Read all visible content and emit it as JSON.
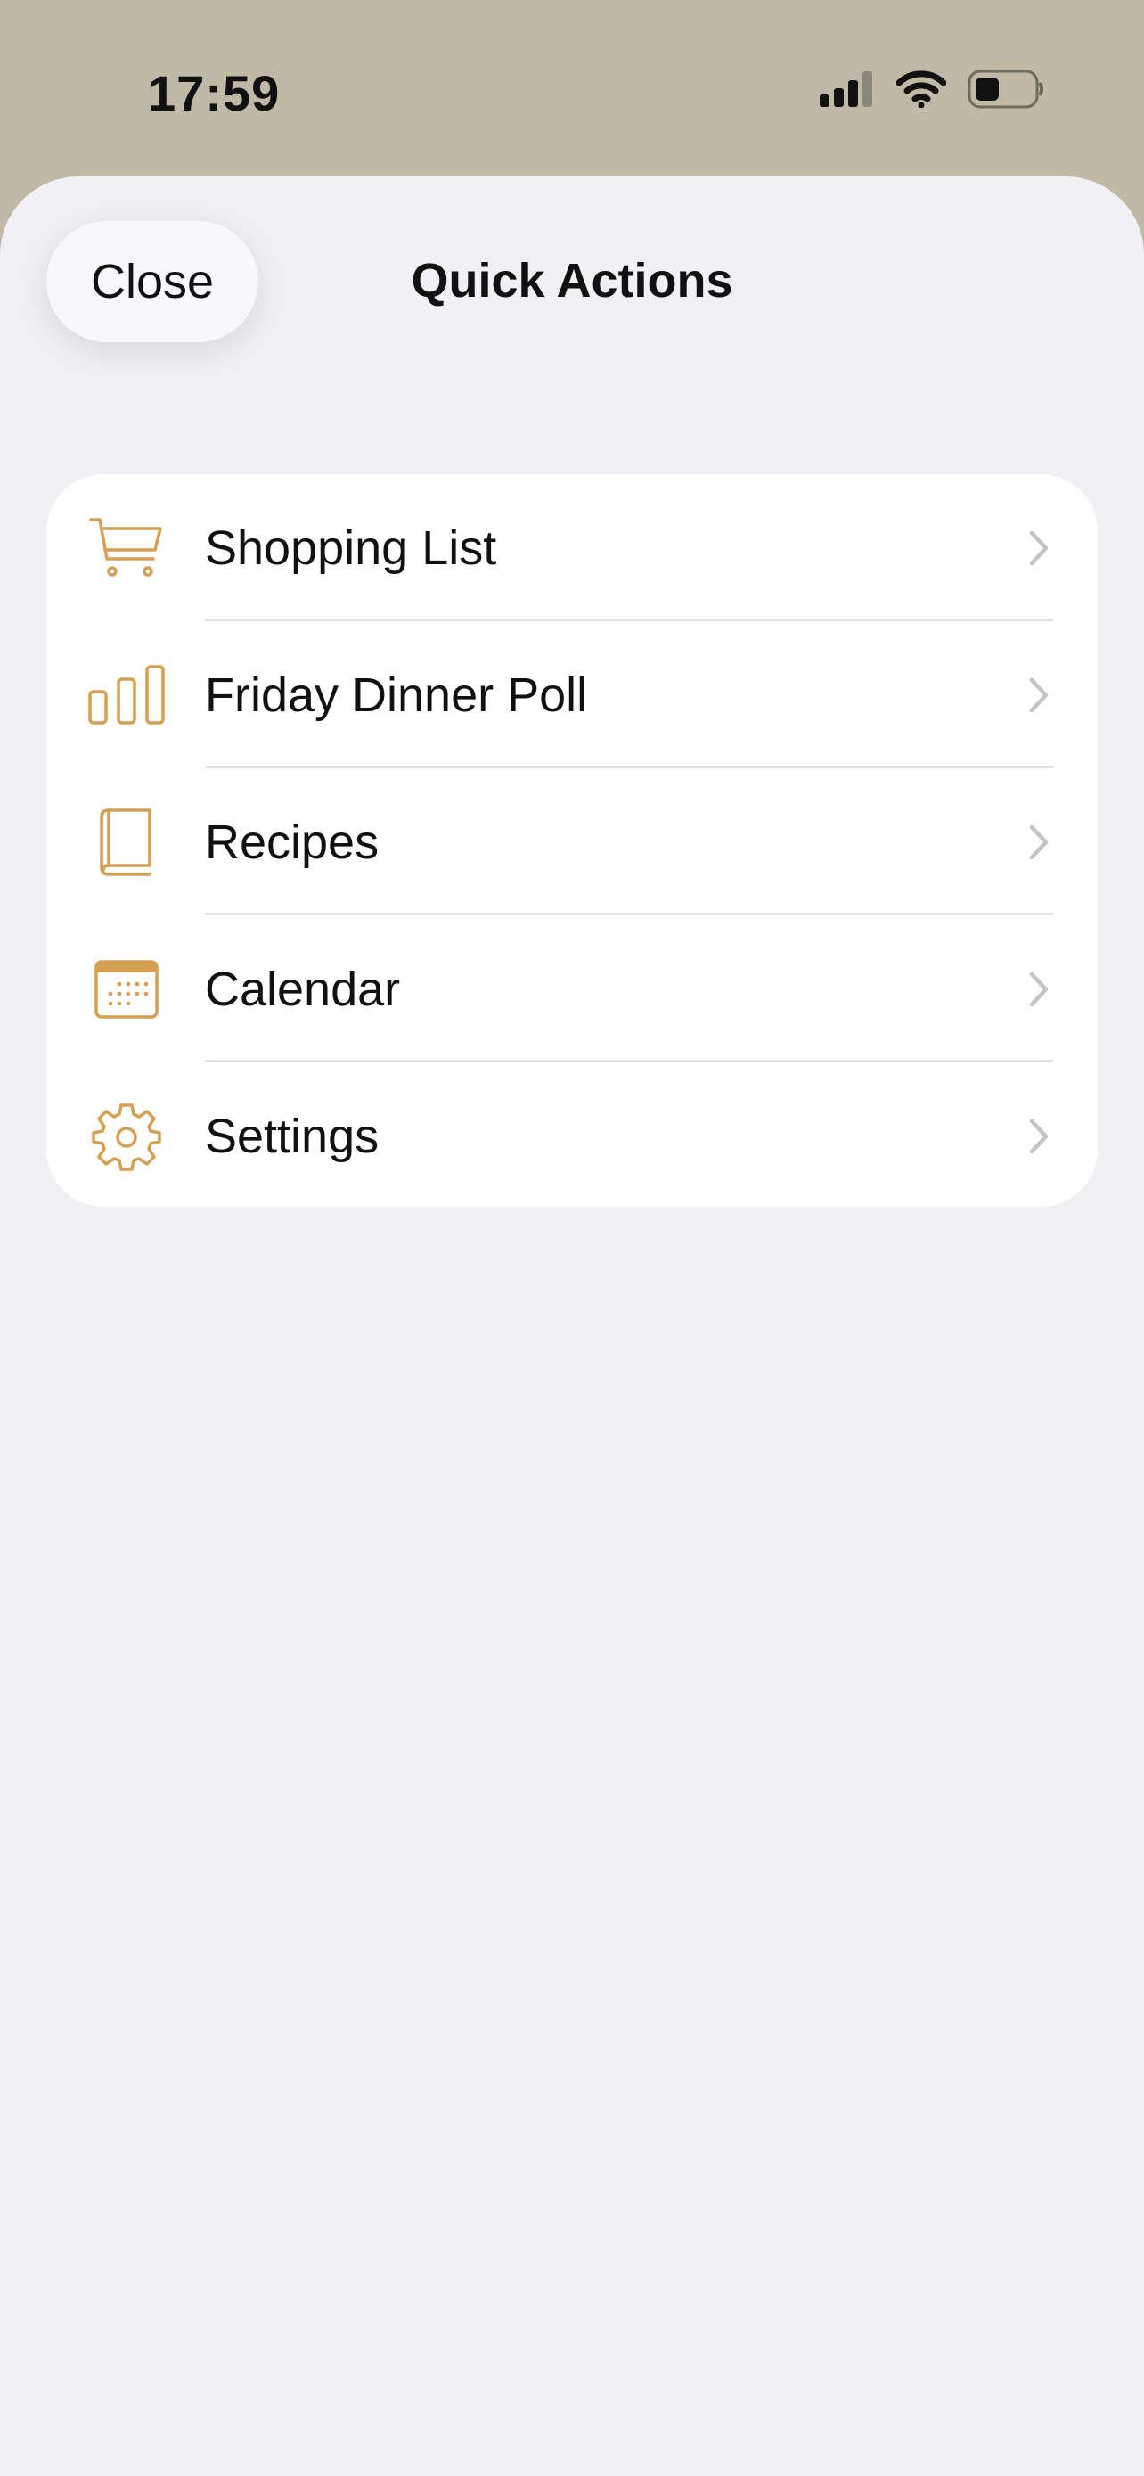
{
  "status_bar": {
    "time": "17:59",
    "icons": [
      "cellular-signal-icon",
      "wifi-icon",
      "battery-icon"
    ]
  },
  "sheet": {
    "close_label": "Close",
    "title": "Quick Actions"
  },
  "list": {
    "items": [
      {
        "label": "Shopping List",
        "icon": "cart-icon"
      },
      {
        "label": "Friday Dinner Poll",
        "icon": "poll-icon"
      },
      {
        "label": "Recipes",
        "icon": "book-icon"
      },
      {
        "label": "Calendar",
        "icon": "calendar-icon"
      },
      {
        "label": "Settings",
        "icon": "gear-icon"
      }
    ]
  },
  "colors": {
    "accent": "#d6a052",
    "backdrop": "#bfb9a6",
    "sheet_bg": "#f0f0f5",
    "card_bg": "#ffffff",
    "chevron": "#c4c4c7"
  }
}
